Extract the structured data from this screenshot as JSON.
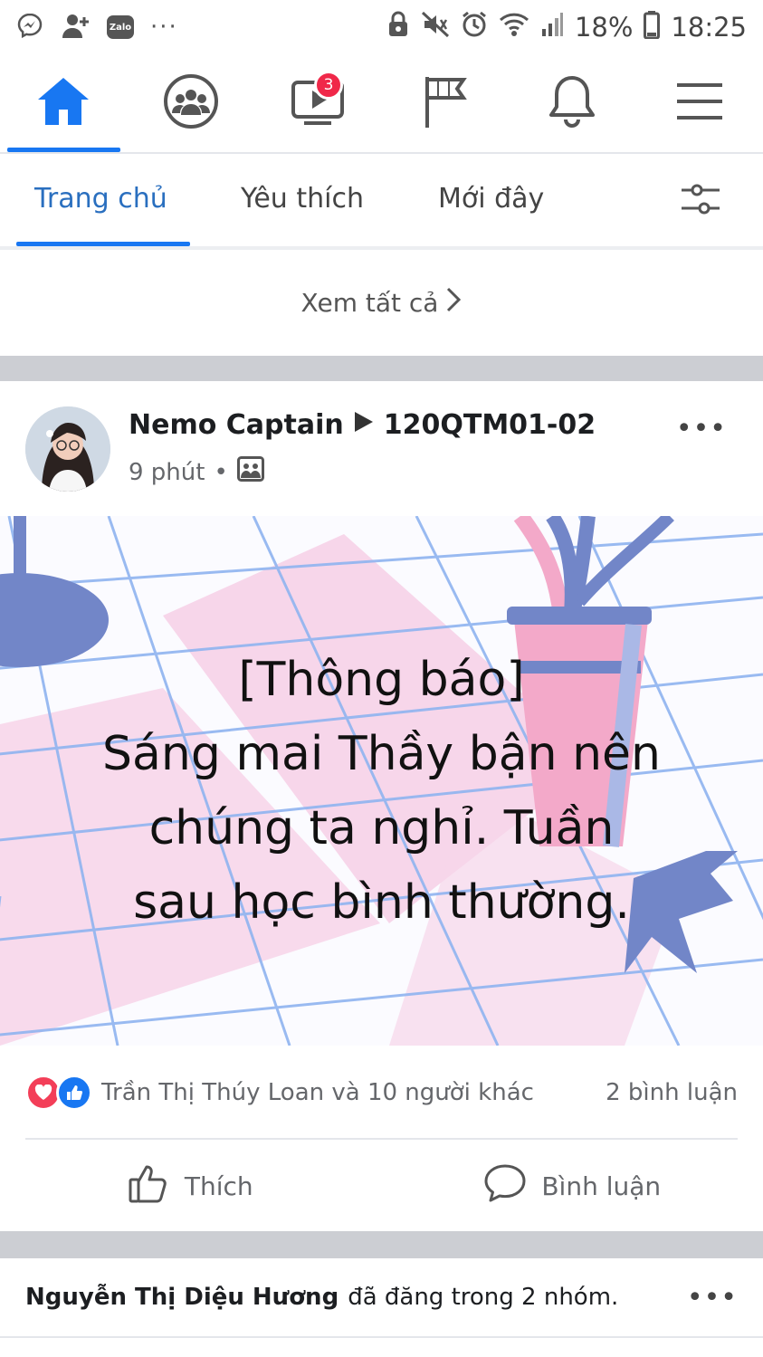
{
  "status_bar": {
    "battery": "18%",
    "time": "18:25",
    "zalo_label": "Zalo",
    "more": "···",
    "icons": [
      "messenger-icon",
      "add-friend-icon",
      "zalo-icon",
      "vpn-icon",
      "mute-icon",
      "alarm-icon",
      "wifi-icon",
      "signal-icon",
      "battery-icon"
    ]
  },
  "top_nav": {
    "items": [
      {
        "name": "home",
        "icon": "home-icon",
        "active": true
      },
      {
        "name": "groups",
        "icon": "groups-icon"
      },
      {
        "name": "watch",
        "icon": "watch-icon",
        "badge": "3"
      },
      {
        "name": "pages",
        "icon": "flag-icon"
      },
      {
        "name": "notifications",
        "icon": "bell-icon"
      },
      {
        "name": "menu",
        "icon": "menu-icon"
      }
    ]
  },
  "sub_tabs": {
    "items": [
      "Trang chủ",
      "Yêu thích",
      "Mới đây"
    ],
    "active": "Trang chủ",
    "filter_icon": "filter-icon"
  },
  "see_all": {
    "label": "Xem tất cả"
  },
  "post": {
    "author": "Nemo Captain",
    "group": "120QTM01-02",
    "time": "9 phút",
    "audience_icon": "group-audience-icon",
    "more": "•••",
    "text_lines": [
      "[Thông báo]",
      "Sáng mai Thầy bận nên",
      "chúng ta nghỉ. Tuần",
      "sau học bình thường."
    ],
    "reactors": "Trần Thị Thúy Loan và 10 người khác",
    "comments": "2 bình luận",
    "actions": {
      "like": "Thích",
      "comment": "Bình luận"
    },
    "colors": {
      "background_pink": "#f7d6ea",
      "grid": "#8fb4f0",
      "plant_blue": "#7286c8",
      "pot_pink": "#f3a9c9"
    }
  },
  "next_post": {
    "author": "Nguyễn Thị Diệu Hương",
    "text": "đã đăng trong 2 nhóm.",
    "more": "•••"
  },
  "colors": {
    "accent": "#1877f2",
    "secondary_text": "#65676b",
    "separator": "#ccced3"
  }
}
